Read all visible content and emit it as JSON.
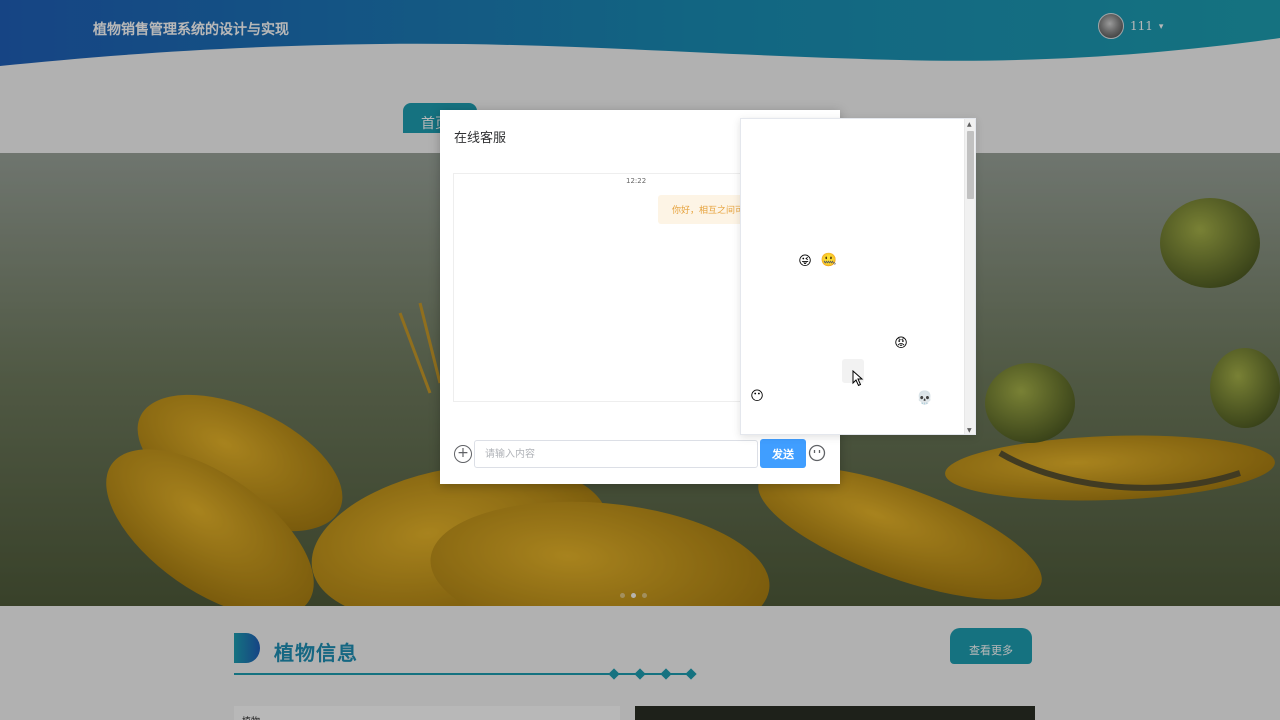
{
  "site": {
    "title": "植物销售管理系统的设计与实现",
    "user_name": "111",
    "caret": "▾",
    "nav_active_label": "首页"
  },
  "section": {
    "title": "植物信息",
    "more_label": "查看更多",
    "card_label": "植物"
  },
  "chat": {
    "title": "在线客服",
    "timestamp": "12:22",
    "message": "你好，相互之间可",
    "input_placeholder": "请输入内容",
    "send_label": "发送",
    "attach_symbol": "+"
  },
  "emoji_picker": {
    "emojis": [
      {
        "name": "tongue-out-emoji",
        "glyph": "😜"
      },
      {
        "name": "zipper-mouth-emoji",
        "glyph": "🤐"
      },
      {
        "name": "angry-face-emoji",
        "glyph": "😡"
      },
      {
        "name": "no-mouth-emoji",
        "glyph": "😶"
      },
      {
        "name": "skull-emoji",
        "glyph": "💀"
      }
    ],
    "scroll_up": "▲",
    "scroll_down": "▼"
  },
  "colors": {
    "header_blue": "#1f5fb8",
    "header_teal": "#1e9fb2",
    "accent_teal": "#1e9fb2",
    "send_button": "#409eff",
    "bubble_text": "#e6a23c",
    "bubble_bg": "#fdf4e5"
  },
  "carousel": {
    "count": 3,
    "active_index": 1
  }
}
